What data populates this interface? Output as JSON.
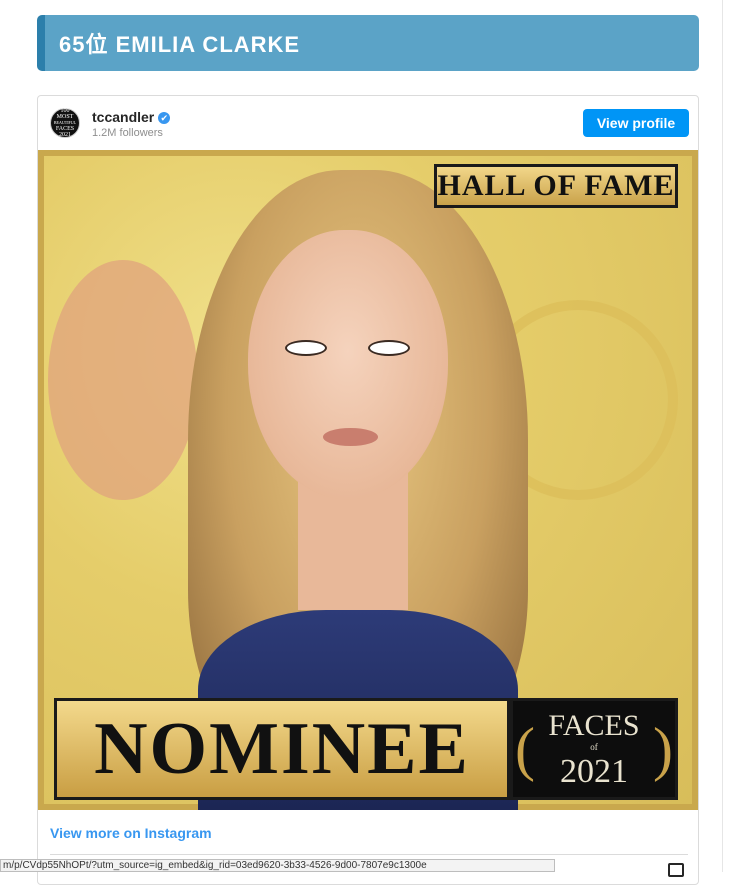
{
  "heading": {
    "title": "65位 EMILIA CLARKE"
  },
  "embed": {
    "username": "tccandler",
    "verified_mark": "✔",
    "followers": "1.2M followers",
    "view_profile_label": "View profile",
    "avatar_text": [
      "100",
      "MOST",
      "BEAUTIFUL",
      "FACES",
      "2021"
    ],
    "image": {
      "hall_of_fame_text": "HALL OF FAME",
      "nominee_text": "NOMINEE",
      "faces_text": "FACES",
      "faces_of": "of",
      "faces_year": "2021"
    },
    "view_more_label": "View more on Instagram"
  },
  "status_bar": {
    "url": "m/p/CVdp55NhOPt/?utm_source=ig_embed&ig_rid=03ed9620-3b33-4526-9d00-7807e9c1300e"
  },
  "colors": {
    "heading_bg": "#5ba3c7",
    "heading_border": "#2c7fab",
    "button_blue": "#0095f6",
    "link_blue": "#3897f0"
  }
}
